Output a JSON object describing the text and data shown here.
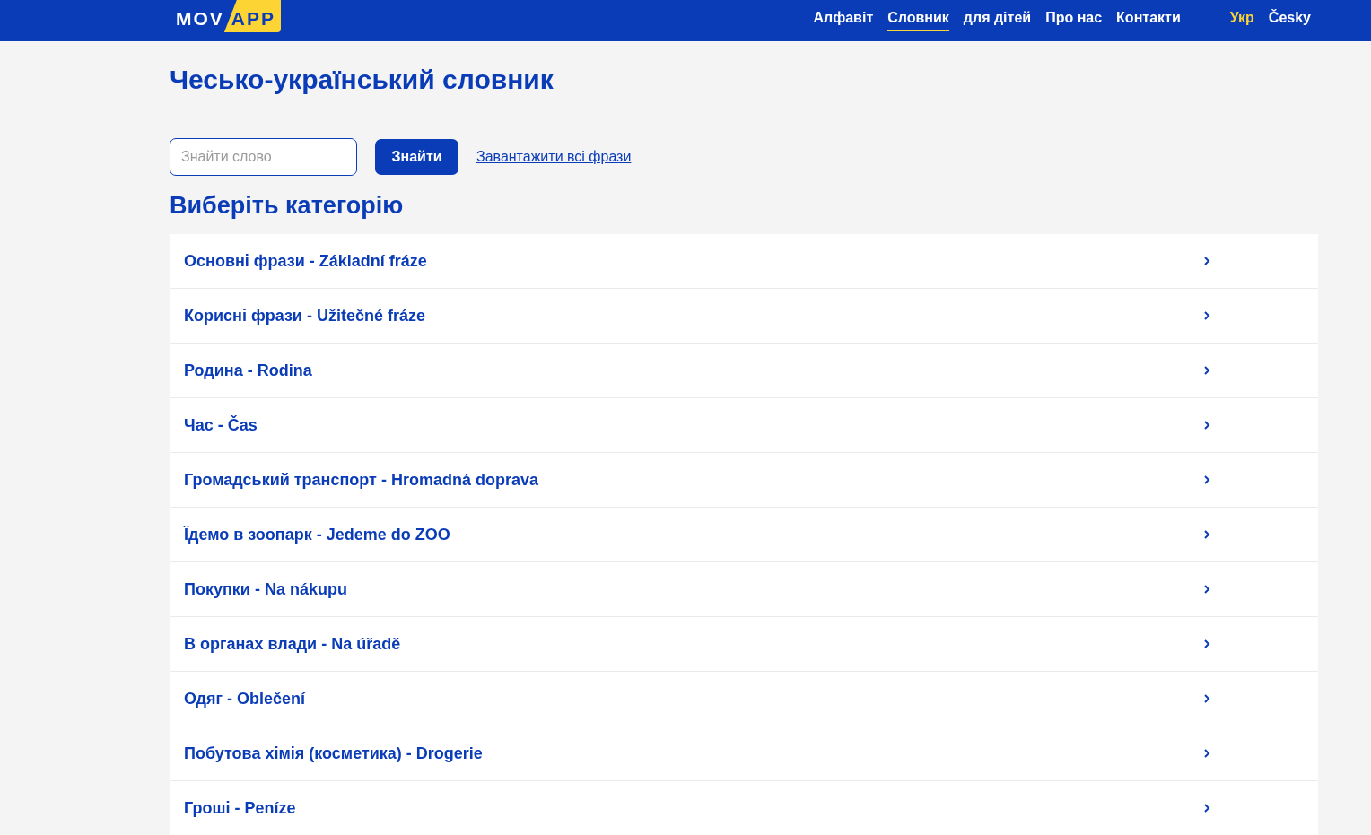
{
  "header": {
    "logo": {
      "part_1": "MOV",
      "part_2": "APP"
    },
    "nav": [
      {
        "label": "Алфавіт",
        "selected": false
      },
      {
        "label": "Словник",
        "selected": true
      },
      {
        "label": "для дітей",
        "selected": false
      },
      {
        "label": "Про нас",
        "selected": false
      },
      {
        "label": "Контакти",
        "selected": false
      }
    ],
    "languages": [
      {
        "label": "Укр",
        "selected": true
      },
      {
        "label": "Česky",
        "selected": false
      }
    ]
  },
  "title": "Чесько-український словник",
  "search": {
    "placeholder": "Знайти слово",
    "button": "Знайти",
    "download_link": "Завантажити всі фрази"
  },
  "categories_heading": "Виберіть категорію",
  "categories": [
    {
      "label": "Основні фрази - Základní fráze"
    },
    {
      "label": "Корисні фрази - Užitečné fráze"
    },
    {
      "label": "Родина - Rodina"
    },
    {
      "label": "Час - Čas"
    },
    {
      "label": "Громадський транспорт - Hromadná doprava"
    },
    {
      "label": "Їдемо в зоопарк - Jedeme do ZOO"
    },
    {
      "label": "Покупки - Na nákupu"
    },
    {
      "label": "В органах влади - Na úřadě"
    },
    {
      "label": "Одяг - Oblečení"
    },
    {
      "label": "Побутова хімія (косметика) - Drogerie"
    },
    {
      "label": "Гроші - Peníze"
    }
  ]
}
